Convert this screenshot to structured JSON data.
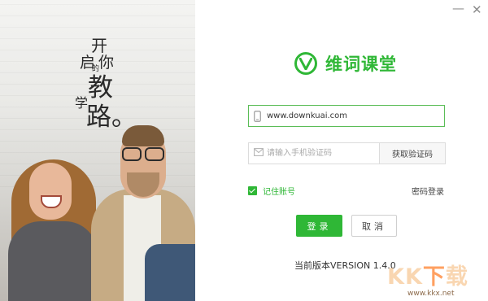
{
  "window": {
    "minimize_symbol": "—",
    "close_symbol": "✕"
  },
  "slogan": {
    "c1": "开",
    "c2": "启",
    "c3": "的",
    "c4": "你",
    "c5": "学",
    "c6": "教",
    "c7": "路。"
  },
  "brand": {
    "name": "维词课堂",
    "color": "#2fb736"
  },
  "login": {
    "account_value": "www.downkuai.com",
    "phone_placeholder": "请输入手机验证码",
    "get_code_label": "获取验证码",
    "remember_label": "记住账号",
    "remember_checked": true,
    "password_login_label": "密码登录",
    "login_button": "登录",
    "cancel_button": "取消"
  },
  "footer": {
    "version": "当前版本VERSION 1.4.0"
  },
  "watermark": {
    "k1": "K",
    "k2": "K",
    "k3": "下",
    "k4": "载",
    "url": "www.kkx.net"
  }
}
